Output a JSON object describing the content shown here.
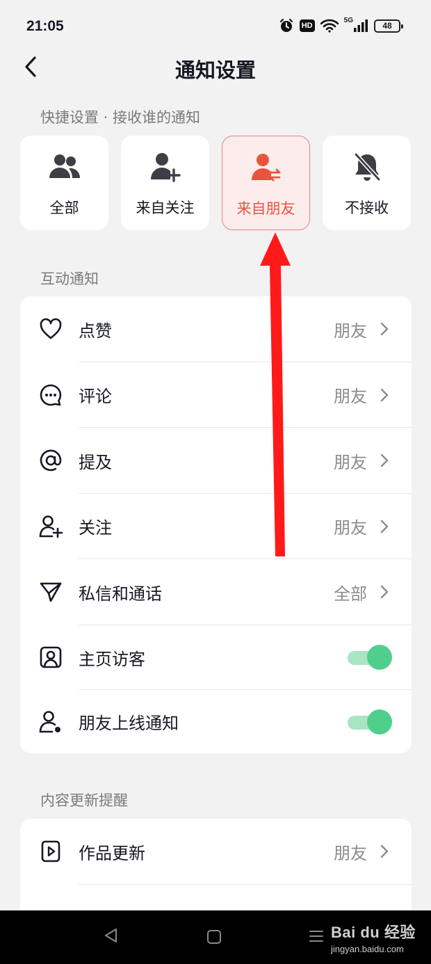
{
  "status_bar": {
    "time": "21:05",
    "hd_label": "HD",
    "network_label": "5G",
    "battery_level": "48",
    "icons": [
      "alarm-icon",
      "hd-icon",
      "wifi-icon",
      "signal-icon",
      "battery-icon"
    ]
  },
  "header": {
    "title": "通知设置",
    "back_icon": "chevron-left-icon"
  },
  "quick_settings": {
    "label": "快捷设置 · 接收谁的通知",
    "options": [
      {
        "label": "全部",
        "icon": "people-icon",
        "selected": false
      },
      {
        "label": "来自关注",
        "icon": "person-add-icon",
        "selected": false
      },
      {
        "label": "来自朋友",
        "icon": "person-swap-icon",
        "selected": true
      },
      {
        "label": "不接收",
        "icon": "bell-off-icon",
        "selected": false
      }
    ]
  },
  "interaction": {
    "label": "互动通知",
    "rows": [
      {
        "label": "点赞",
        "value": "朋友",
        "icon": "heart-icon"
      },
      {
        "label": "评论",
        "value": "朋友",
        "icon": "comment-icon"
      },
      {
        "label": "提及",
        "value": "朋友",
        "icon": "at-icon"
      },
      {
        "label": "关注",
        "value": "朋友",
        "icon": "person-add-icon"
      },
      {
        "label": "私信和通话",
        "value": "全部",
        "icon": "send-icon"
      },
      {
        "label": "主页访客",
        "toggle": true,
        "icon": "profile-card-icon"
      },
      {
        "label": "朋友上线通知",
        "toggle": true,
        "icon": "person-online-icon"
      }
    ]
  },
  "content_updates": {
    "label": "内容更新提醒",
    "rows": [
      {
        "label": "作品更新",
        "value": "朋友",
        "icon": "video-icon"
      }
    ]
  },
  "colors": {
    "accent_red": "#e8553f",
    "toggle_on": "#4fcf8b",
    "annotation_arrow": "#ff1a1a"
  },
  "watermark": {
    "logo": "Bai du 经验",
    "url": "jingyan.baidu.com"
  }
}
